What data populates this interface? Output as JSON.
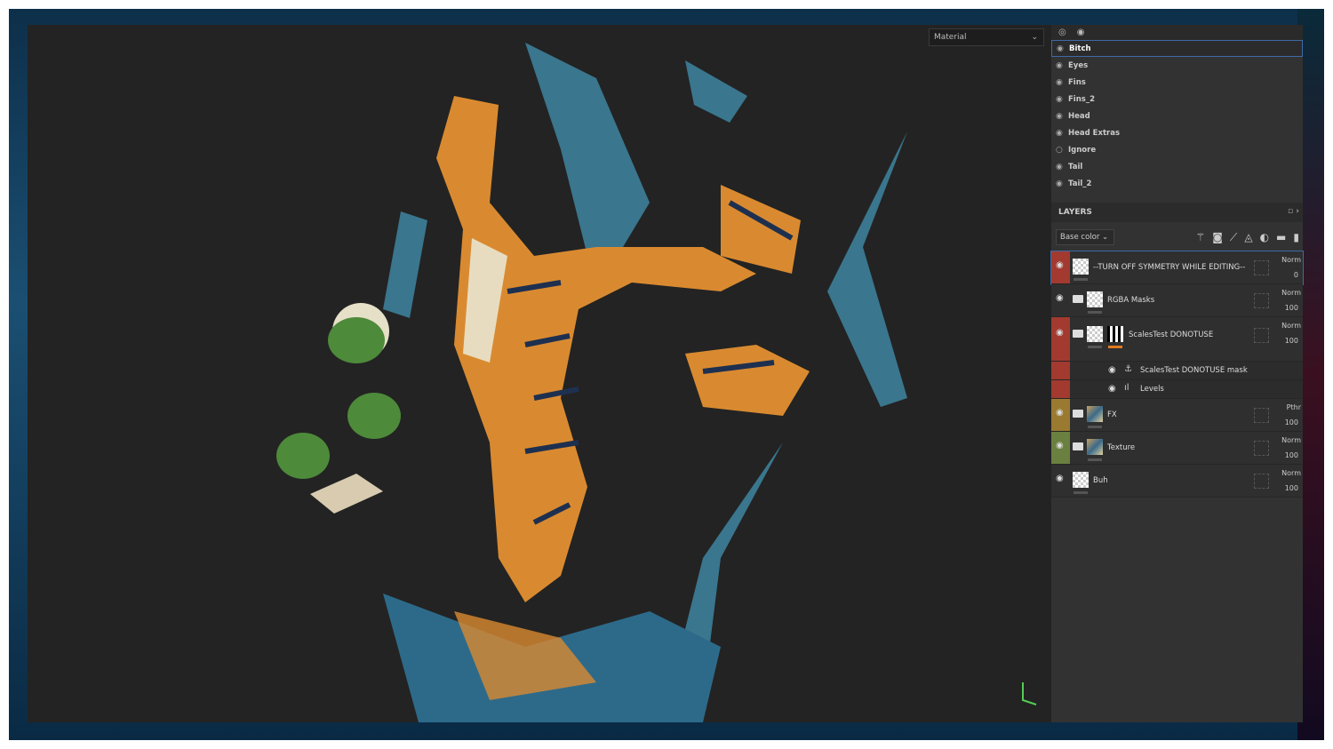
{
  "viewport": {
    "material_select": "Material"
  },
  "texture_sets": [
    "Bitch",
    "Eyes",
    "Fins",
    "Fins_2",
    "Head",
    "Head Extras",
    "Ignore",
    "Tail",
    "Tail_2"
  ],
  "texture_set_visible": [
    true,
    true,
    true,
    true,
    true,
    true,
    false,
    true,
    true
  ],
  "selected_texture_set": "Bitch",
  "layers_panel": {
    "title": "LAYERS",
    "channel": "Base color"
  },
  "layers": [
    {
      "name": "--TURN OFF SYMMETRY WHILE EDITING--",
      "blend": "Norm",
      "opacity": "0",
      "color": "#a23a30"
    },
    {
      "name": "RGBA Masks",
      "blend": "Norm",
      "opacity": "100",
      "color": ""
    },
    {
      "name": "ScalesTest DONOTUSE",
      "blend": "Norm",
      "opacity": "100",
      "color": "#a23a30"
    },
    {
      "name": "ScalesTest DONOTUSE mask",
      "blend": "",
      "opacity": "",
      "color": ""
    },
    {
      "name": "Levels",
      "blend": "",
      "opacity": "",
      "color": ""
    },
    {
      "name": "FX",
      "blend": "Pthr",
      "opacity": "100",
      "color": "#9a7a30"
    },
    {
      "name": "Texture",
      "blend": "Norm",
      "opacity": "100",
      "color": "#6a8040"
    },
    {
      "name": "Buh",
      "blend": "Norm",
      "opacity": "100",
      "color": ""
    }
  ]
}
